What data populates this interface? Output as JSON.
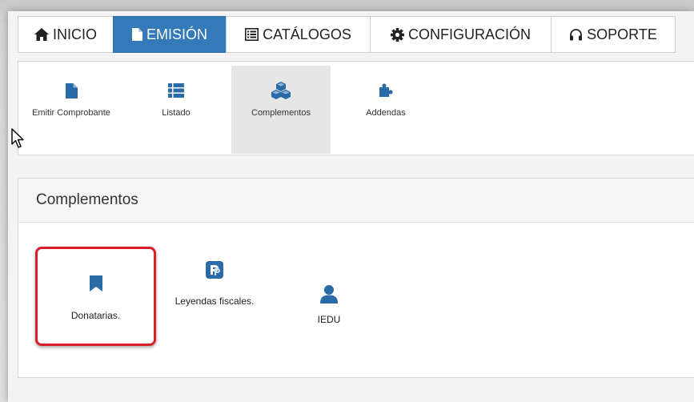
{
  "nav": {
    "tabs": [
      {
        "label": "INICIO",
        "icon": "home-icon",
        "active": false
      },
      {
        "label": "EMISIÓN",
        "icon": "file-icon",
        "active": true
      },
      {
        "label": "CATÁLOGOS",
        "icon": "list-alt-icon",
        "active": false
      },
      {
        "label": "CONFIGURACIÓN",
        "icon": "gear-icon",
        "active": false
      },
      {
        "label": "SOPORTE",
        "icon": "headphones-icon",
        "active": false
      }
    ]
  },
  "toolbar": {
    "items": [
      {
        "label": "Emitir Comprobante",
        "icon": "file-icon",
        "selected": false
      },
      {
        "label": "Listado",
        "icon": "list-icon",
        "selected": false
      },
      {
        "label": "Complementos",
        "icon": "cubes-icon",
        "selected": true
      },
      {
        "label": "Addendas",
        "icon": "puzzle-icon",
        "selected": false
      }
    ]
  },
  "panel": {
    "title": "Complementos",
    "items": [
      {
        "label": "Donatarias.",
        "icon": "bookmark-icon",
        "highlighted": true
      },
      {
        "label": "Leyendas fiscales.",
        "icon": "product-hunt-icon",
        "highlighted": false
      },
      {
        "label": "IEDU",
        "icon": "user-icon",
        "highlighted": false
      }
    ]
  },
  "colors": {
    "accent": "#3479b8",
    "icon": "#2a6aa6",
    "highlight": "#d91f26"
  }
}
